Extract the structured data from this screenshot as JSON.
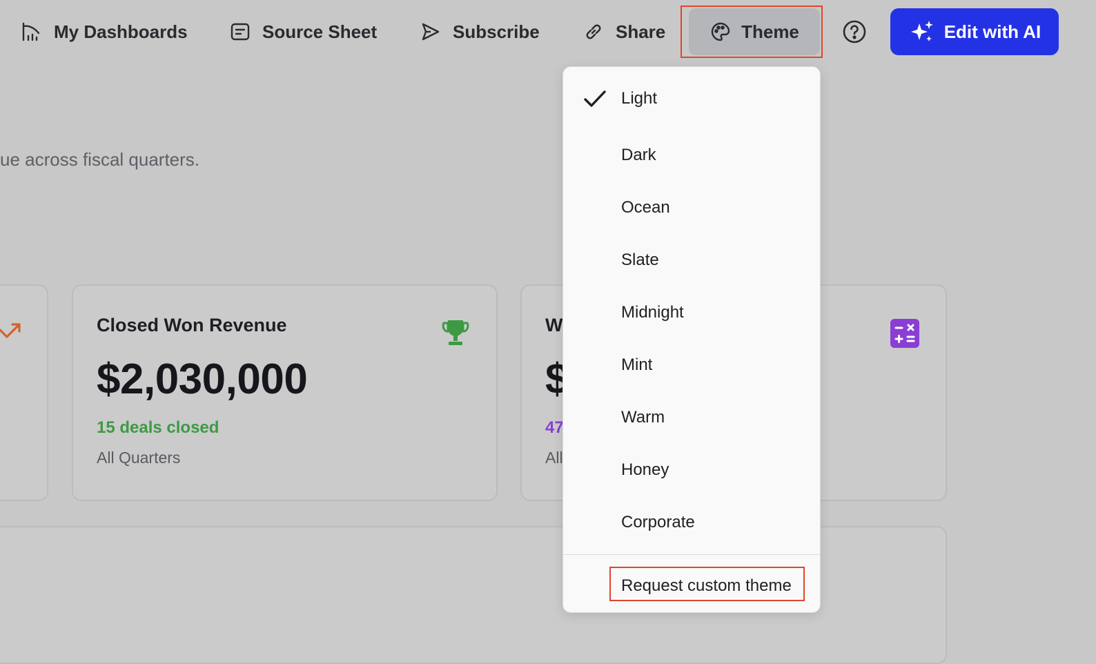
{
  "nav": {
    "my_dashboards": "My Dashboards",
    "source_sheet": "Source Sheet",
    "subscribe": "Subscribe",
    "share": "Share",
    "theme": "Theme",
    "edit_ai": "Edit with AI"
  },
  "subtitle": "ue across fiscal quarters.",
  "cards": {
    "main": {
      "title": "Closed Won Revenue",
      "value": "$2,030,000",
      "note": "15 deals closed",
      "sub": "All Quarters"
    },
    "right": {
      "title": "W",
      "value": "$",
      "note": "47",
      "sub": "All"
    }
  },
  "theme_menu": {
    "items": [
      "Light",
      "Dark",
      "Ocean",
      "Slate",
      "Midnight",
      "Mint",
      "Warm",
      "Honey",
      "Corporate"
    ],
    "selected": "Light",
    "request": "Request custom theme"
  },
  "colors": {
    "accent": "#2432e6",
    "highlight": "#e0452f",
    "positive": "#3d9a43",
    "purple": "#8a3ed4"
  }
}
